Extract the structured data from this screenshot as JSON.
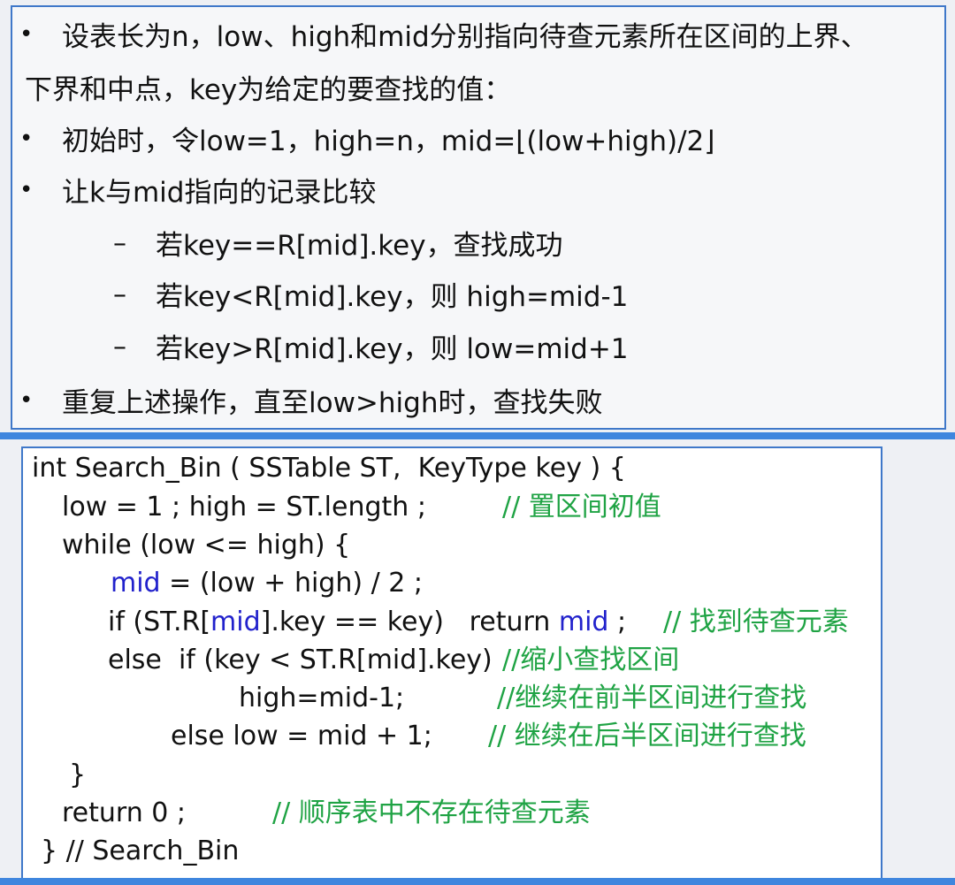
{
  "description": {
    "intro_line1": "设表长为n，low、high和mid分别指向待查元素所在区间的上界、",
    "intro_line2": "下界和中点，key为给定的要查找的值：",
    "init": "初始时，令low=1，high=n，mid=⌊(low+high)/2⌋",
    "compare": "让k与mid指向的记录比较",
    "case_equal": "若key==R[mid].key，查找成功",
    "case_less": "若key<R[mid].key，则 high=mid-1",
    "case_greater": "若key>R[mid].key，则 low=mid+1",
    "repeat": "重复上述操作，直至low>high时，查找失败",
    "bullet": "•",
    "dash": "–"
  },
  "code": {
    "l1": "int Search_Bin ( SSTable ST,  KeyType key ) {",
    "l2_code": "low = 1 ; high = ST.length ;",
    "l2_comment": "// 置区间初值",
    "l3": "while (low <= high) {",
    "l4_mid": "mid",
    "l4_rest": " = (low + high) / 2 ;",
    "l5_a": "if (ST.R[",
    "l5_mid1": "mid",
    "l5_b": "].key == key)   return ",
    "l5_mid2": "mid",
    "l5_c": " ;",
    "l5_comment": "// 找到待查元素",
    "l6_code": "else  if (key < ST.R[mid].key)",
    "l6_comment": "//缩小查找区间",
    "l7_code": "high=mid-1;",
    "l7_comment": "//继续在前半区间进行查找",
    "l8_code": "else low = mid + 1;",
    "l8_comment": "// 继续在后半区间进行查找",
    "l9": "}",
    "l10_code": "return 0 ;",
    "l10_comment": "// 顺序表中不存在待查元素",
    "l11": "} // Search_Bin"
  },
  "colors": {
    "comment": "#1fa344",
    "keyword": "#2222cc",
    "border": "#3f78c9",
    "bar": "#3f86de"
  }
}
